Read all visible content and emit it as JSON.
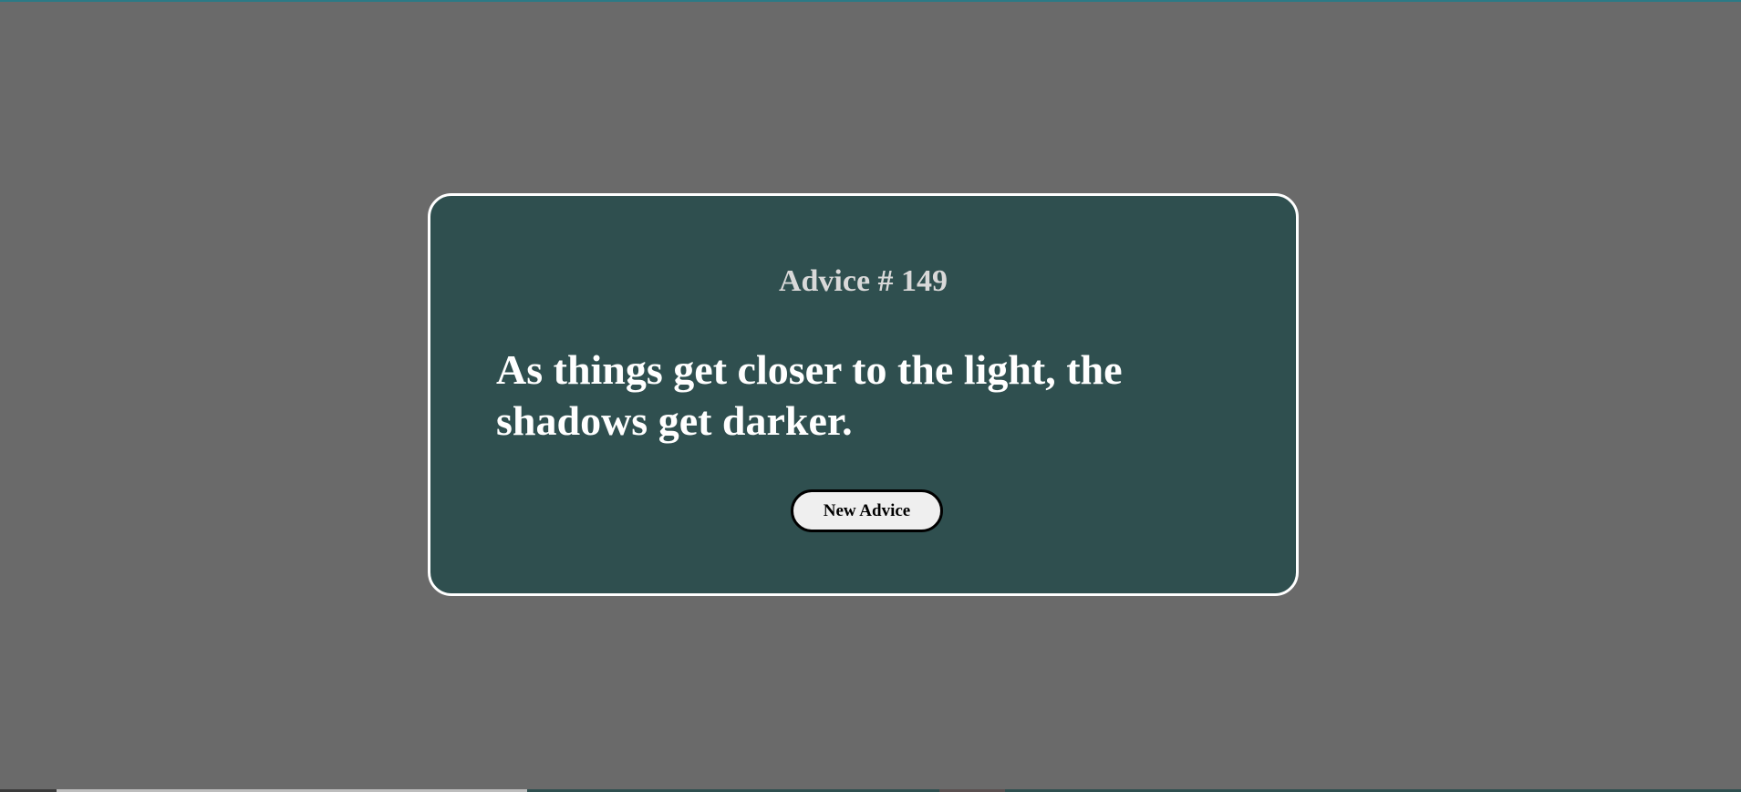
{
  "card": {
    "advice_id_label": "Advice # 149",
    "advice_text": "As things get closer to the light, the shadows get darker.",
    "button_label": "New Advice"
  },
  "colors": {
    "page_background": "#6a6a6a",
    "card_background": "#2f4f4f",
    "card_border": "#ffffff",
    "advice_id_text": "#d9d9d9",
    "advice_text": "#ffffff",
    "button_background": "#efefef",
    "button_border": "#000000"
  }
}
